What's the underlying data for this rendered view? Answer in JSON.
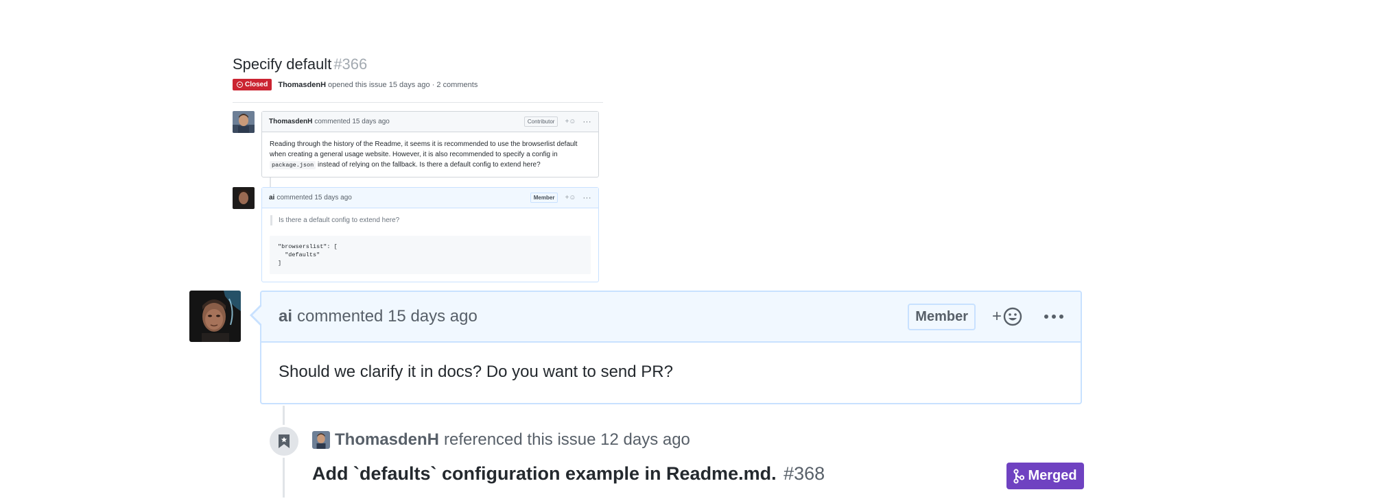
{
  "embedded_screenshot": {
    "issue_title": "Specify default",
    "issue_number": "#366",
    "state_label": "Closed",
    "opened_by": "ThomasdenH",
    "opened_text": "opened this issue 15 days ago · 2 comments",
    "comments": [
      {
        "author": "ThomasdenH",
        "action": "commented 15 days ago",
        "role_label": "Contributor",
        "body_part1": "Reading through the history of the Readme, it seems it is recommended to use the browserlist default when creating a general usage website. However, it is also recommended to specify a config in",
        "body_code": "package.json",
        "body_part2": "instead of relying on the fallback. Is there a default config to extend here?"
      },
      {
        "author": "ai",
        "action": "commented 15 days ago",
        "role_label": "Member",
        "quote": "Is there a default config to extend here?",
        "code_lines": [
          "\"browserslist\": [",
          "  \"defaults\"",
          "]"
        ]
      }
    ]
  },
  "main_comment": {
    "author": "ai",
    "action": "commented 15 days ago",
    "role_label": "Member",
    "reaction_plus": "+",
    "body": "Should we clarify it in docs? Do you want to send PR?"
  },
  "reference_event": {
    "author": "ThomasdenH",
    "action": "referenced this issue 12 days ago",
    "pr_title": "Add `defaults` configuration example in Readme.md.",
    "pr_number": "#368",
    "pr_state": "Merged"
  },
  "colors": {
    "closed": "#cb2431",
    "merged": "#6f42c1",
    "comment_border": "#c8e1ff",
    "comment_header_bg": "#f1f8ff"
  },
  "icons": [
    "closed-issue-icon",
    "smiley-icon",
    "kebab-icon",
    "bookmark-icon",
    "git-merge-icon"
  ]
}
